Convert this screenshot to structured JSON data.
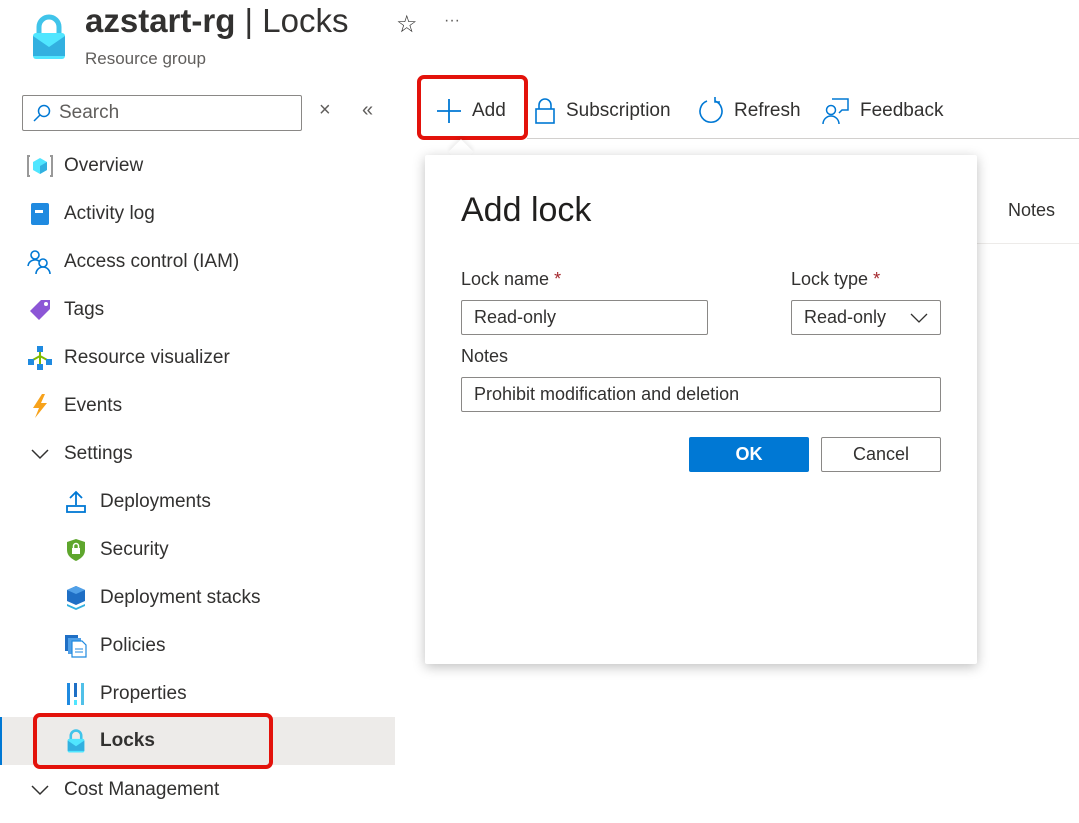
{
  "header": {
    "resource_name": "azstart-rg",
    "separator": " | ",
    "page": "Locks",
    "subtitle": "Resource group",
    "favorite_icon": "star-icon",
    "more_icon": "ellipsis-icon",
    "more_label": "···",
    "star_label": "☆"
  },
  "search": {
    "placeholder": "Search",
    "clear_label": "×",
    "collapse_label": "«"
  },
  "sidebar": {
    "items": [
      {
        "label": "Overview",
        "icon": "overview-cube-icon"
      },
      {
        "label": "Activity log",
        "icon": "activity-log-icon"
      },
      {
        "label": "Access control (IAM)",
        "icon": "people-icon"
      },
      {
        "label": "Tags",
        "icon": "tag-icon"
      },
      {
        "label": "Resource visualizer",
        "icon": "visualizer-icon"
      },
      {
        "label": "Events",
        "icon": "lightning-icon"
      },
      {
        "label": "Settings",
        "icon": "chevron-down-icon",
        "expanded": true
      },
      {
        "label": "Deployments",
        "icon": "upload-icon"
      },
      {
        "label": "Security",
        "icon": "shield-icon"
      },
      {
        "label": "Deployment stacks",
        "icon": "stack-icon"
      },
      {
        "label": "Policies",
        "icon": "policy-icon"
      },
      {
        "label": "Properties",
        "icon": "properties-icon"
      },
      {
        "label": "Locks",
        "icon": "lock-icon",
        "selected": true
      },
      {
        "label": "Cost Management",
        "icon": "chevron-down-icon",
        "expanded": true
      }
    ]
  },
  "toolbar": {
    "add": "Add",
    "subscription": "Subscription",
    "refresh": "Refresh",
    "feedback": "Feedback"
  },
  "table": {
    "notes_header": "Notes"
  },
  "dialog": {
    "title": "Add lock",
    "lock_name_label": "Lock name",
    "required_mark": "*",
    "lock_name_value": "Read-only",
    "lock_type_label": "Lock type",
    "lock_type_value": "Read-only",
    "notes_label": "Notes",
    "notes_value": "Prohibit modification and deletion",
    "ok": "OK",
    "cancel": "Cancel"
  },
  "colors": {
    "accent": "#0078d4",
    "highlight": "#e3120b",
    "selected_bg": "#edebe9"
  }
}
